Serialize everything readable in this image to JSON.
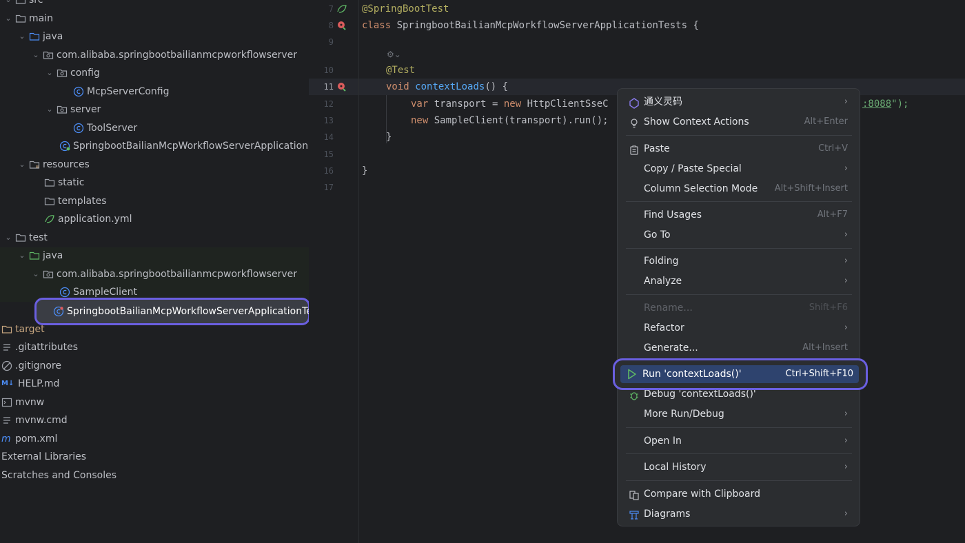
{
  "tree": {
    "items": [
      {
        "label": "src"
      },
      {
        "label": "main"
      },
      {
        "label": "java"
      },
      {
        "label": "com.alibaba.springbootbailianmcpworkflowserver"
      },
      {
        "label": "config"
      },
      {
        "label": "McpServerConfig"
      },
      {
        "label": "server"
      },
      {
        "label": "ToolServer"
      },
      {
        "label": "SpringbootBailianMcpWorkflowServerApplication"
      },
      {
        "label": "resources"
      },
      {
        "label": "static"
      },
      {
        "label": "templates"
      },
      {
        "label": "application.yml"
      },
      {
        "label": "test"
      },
      {
        "label": "java"
      },
      {
        "label": "com.alibaba.springbootbailianmcpworkflowserver"
      },
      {
        "label": "SampleClient"
      },
      {
        "label": "SpringbootBailianMcpWorkflowServerApplicationTes"
      },
      {
        "label": "target"
      },
      {
        "label": ".gitattributes"
      },
      {
        "label": ".gitignore"
      },
      {
        "label": "HELP.md"
      },
      {
        "label": "mvnw"
      },
      {
        "label": "mvnw.cmd"
      },
      {
        "label": "pom.xml"
      },
      {
        "label": "External Libraries"
      },
      {
        "label": "Scratches and Consoles"
      }
    ]
  },
  "editor": {
    "line_numbers": [
      "7",
      "8",
      "9",
      "10",
      "11",
      "12",
      "13",
      "14",
      "15",
      "16",
      "17"
    ],
    "lines": {
      "l7_ann": "@SpringBootTest",
      "l8_kw": "class ",
      "l8_name": "SpringbootBailianMcpWorkflowServerApplicationTests {",
      "l10_ann": "@Test",
      "l11_kw": "void ",
      "l11_fn": "contextLoads",
      "l11_rest": "() {",
      "l12_kw1": "var ",
      "l12_a": "transport = ",
      "l12_kw2": "new ",
      "l12_b": "HttpClientSseC",
      "l12_str": ":8088",
      "l12_end": "\");",
      "l13_kw": "new ",
      "l13_rest": "SampleClient(transport).run();",
      "l14": "}",
      "l16": "}"
    }
  },
  "menu": {
    "items": {
      "tongyi": "通义灵码",
      "context_actions": "Show Context Actions",
      "context_actions_sc": "Alt+Enter",
      "paste": "Paste",
      "paste_sc": "Ctrl+V",
      "copy_paste_special": "Copy / Paste Special",
      "column_selection": "Column Selection Mode",
      "column_selection_sc": "Alt+Shift+Insert",
      "find_usages": "Find Usages",
      "find_usages_sc": "Alt+F7",
      "go_to": "Go To",
      "folding": "Folding",
      "analyze": "Analyze",
      "rename": "Rename...",
      "rename_sc": "Shift+F6",
      "refactor": "Refactor",
      "generate": "Generate...",
      "generate_sc": "Alt+Insert",
      "run": "Run 'contextLoads()'",
      "run_sc": "Ctrl+Shift+F10",
      "debug": "Debug 'contextLoads()'",
      "more_run": "More Run/Debug",
      "open_in": "Open In",
      "local_history": "Local History",
      "compare_clipboard": "Compare with Clipboard",
      "diagrams": "Diagrams"
    },
    "submenu_glyph": "›"
  },
  "colors": {
    "highlight_border": "#6a5fe0",
    "menu_selected": "#2e436e",
    "run_green": "#5fb865"
  }
}
